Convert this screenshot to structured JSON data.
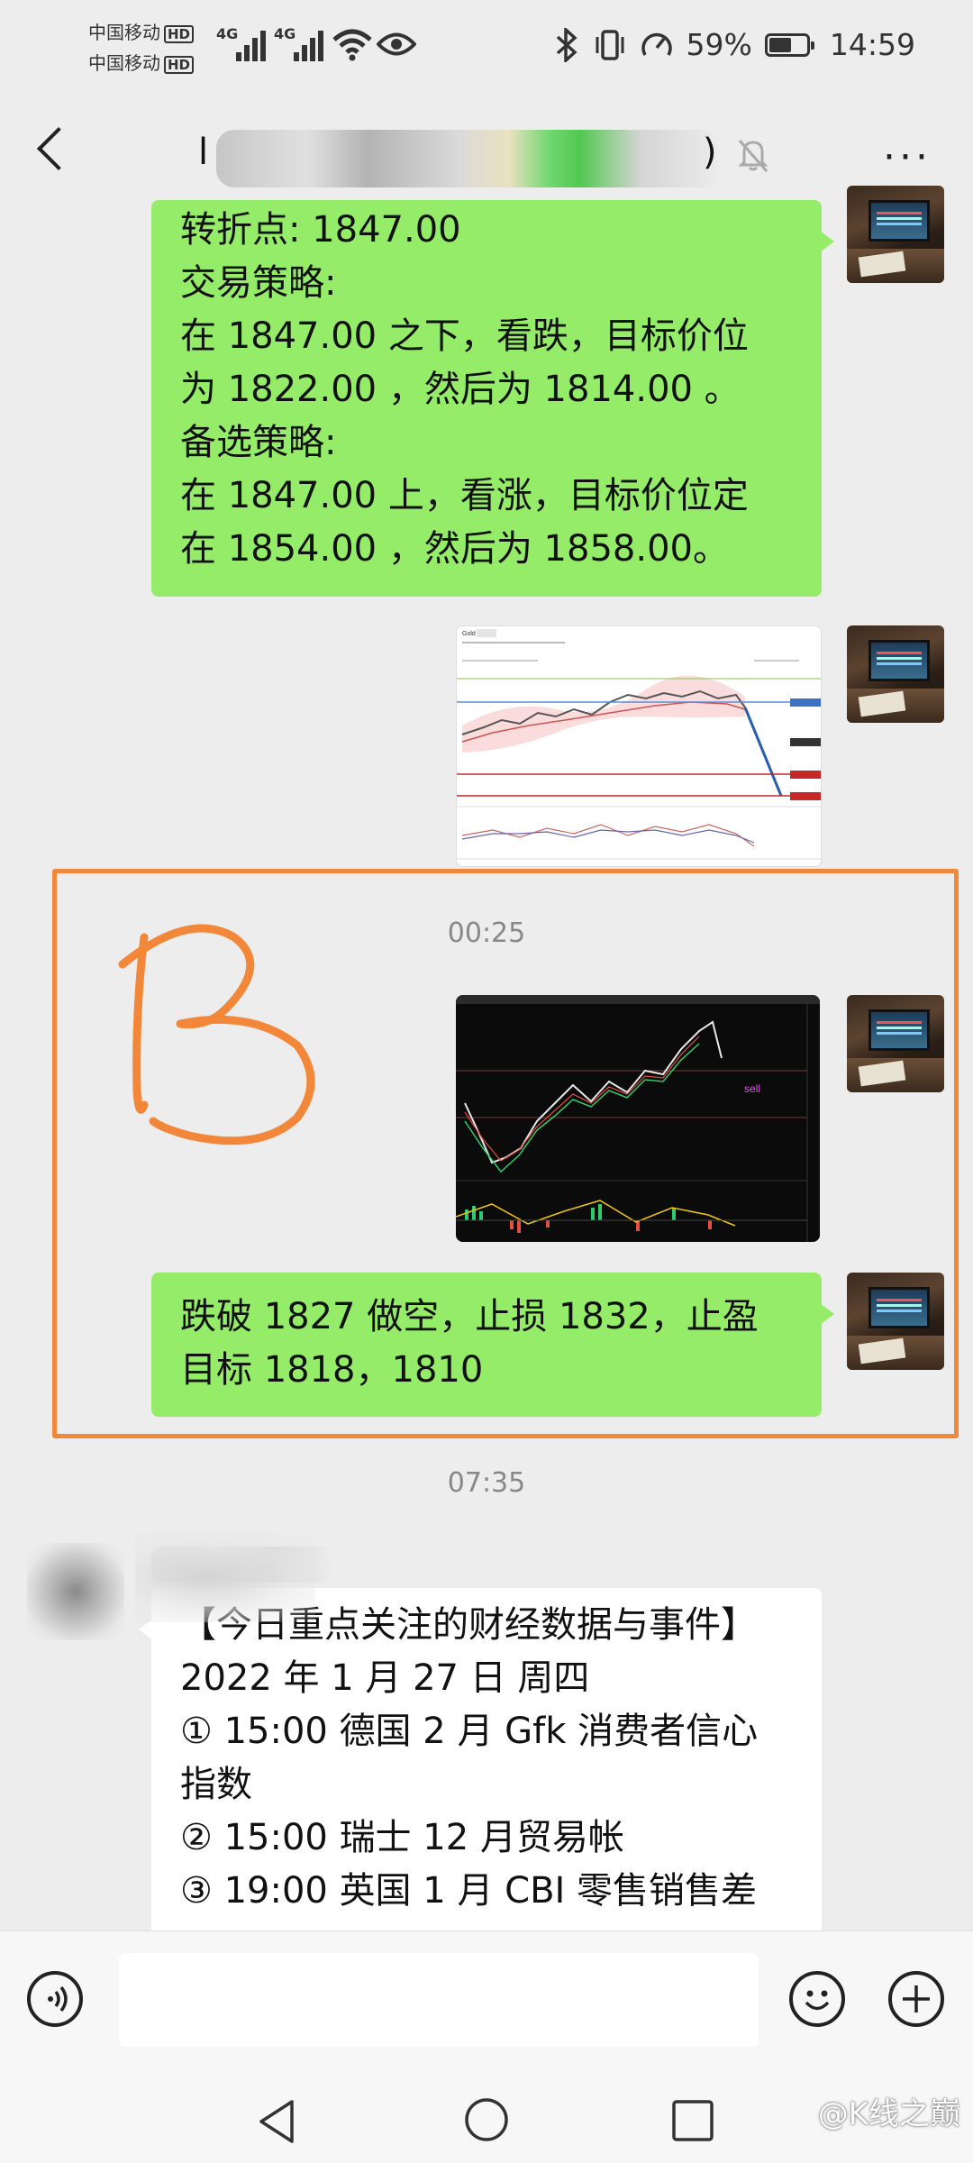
{
  "status_bar": {
    "carrier1": "中国移动",
    "carrier2": "中国移动",
    "hd": "HD",
    "net1": "4G",
    "net2": "4G",
    "battery_pct": "59%",
    "battery_level": 0.59,
    "time": "14:59"
  },
  "header": {
    "title_prefix": "l",
    "title_suffix": ")"
  },
  "messages": {
    "strategy": {
      "lines": [
        "转折点: 1847.00",
        "交易策略:",
        "在 1847.00 之下，看跌，目标价位",
        "为 1822.00 ，然后为 1814.00 。",
        "备选策略:",
        "在 1847.00 上，看涨，目标价位定",
        "在 1854.00 ，然后为 1858.00。"
      ]
    },
    "gold_chart": {
      "label": "Gold"
    },
    "time_1": "00:25",
    "dark_chart": {
      "sell_label": "sell"
    },
    "trade_signal": {
      "lines": [
        "跌破 1827 做空，止损 1832，止盈",
        "目标 1818，1810"
      ]
    },
    "time_2": "07:35",
    "news": {
      "lines": [
        "【今日重点关注的财经数据与事件】",
        "2022 年 1 月 27 日 周四",
        " ① 15:00 德国 2 月 Gfk 消费者信心",
        "指数",
        " ② 15:00 瑞士 12 月贸易帐",
        " ③ 19:00 英国 1 月 CBI 零售销售差"
      ]
    }
  },
  "annotation": {
    "letter": "B",
    "color": "#f2873a"
  },
  "watermark": "@K线之巅",
  "colors": {
    "bubble_green": "#95ec69",
    "background": "#ededed",
    "highlight_orange": "#f2873a"
  }
}
